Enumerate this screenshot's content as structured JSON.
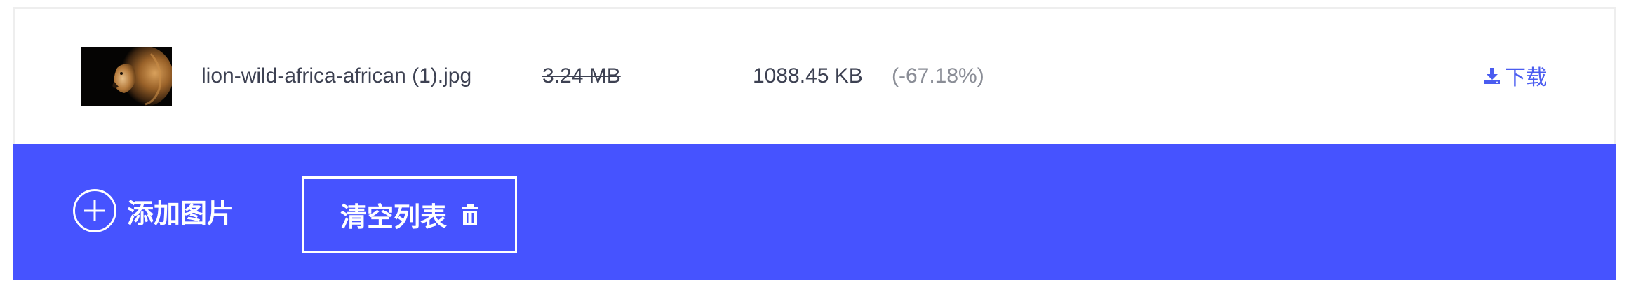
{
  "file": {
    "name": "lion-wild-africa-african (1).jpg",
    "original_size": "3.24 MB",
    "compressed_size": "1088.45 KB",
    "reduction": "(-67.18%)",
    "download_label": "下载",
    "thumbnail_icon": "lion-thumbnail-image"
  },
  "actions": {
    "add_label": "添加图片",
    "clear_label": "清空列表",
    "add_icon": "plus-circle-icon",
    "clear_icon": "trash-icon"
  },
  "colors": {
    "accent": "#4653ff",
    "link": "#4a5cf0",
    "text": "#3d4152",
    "muted": "#8a8d96"
  }
}
